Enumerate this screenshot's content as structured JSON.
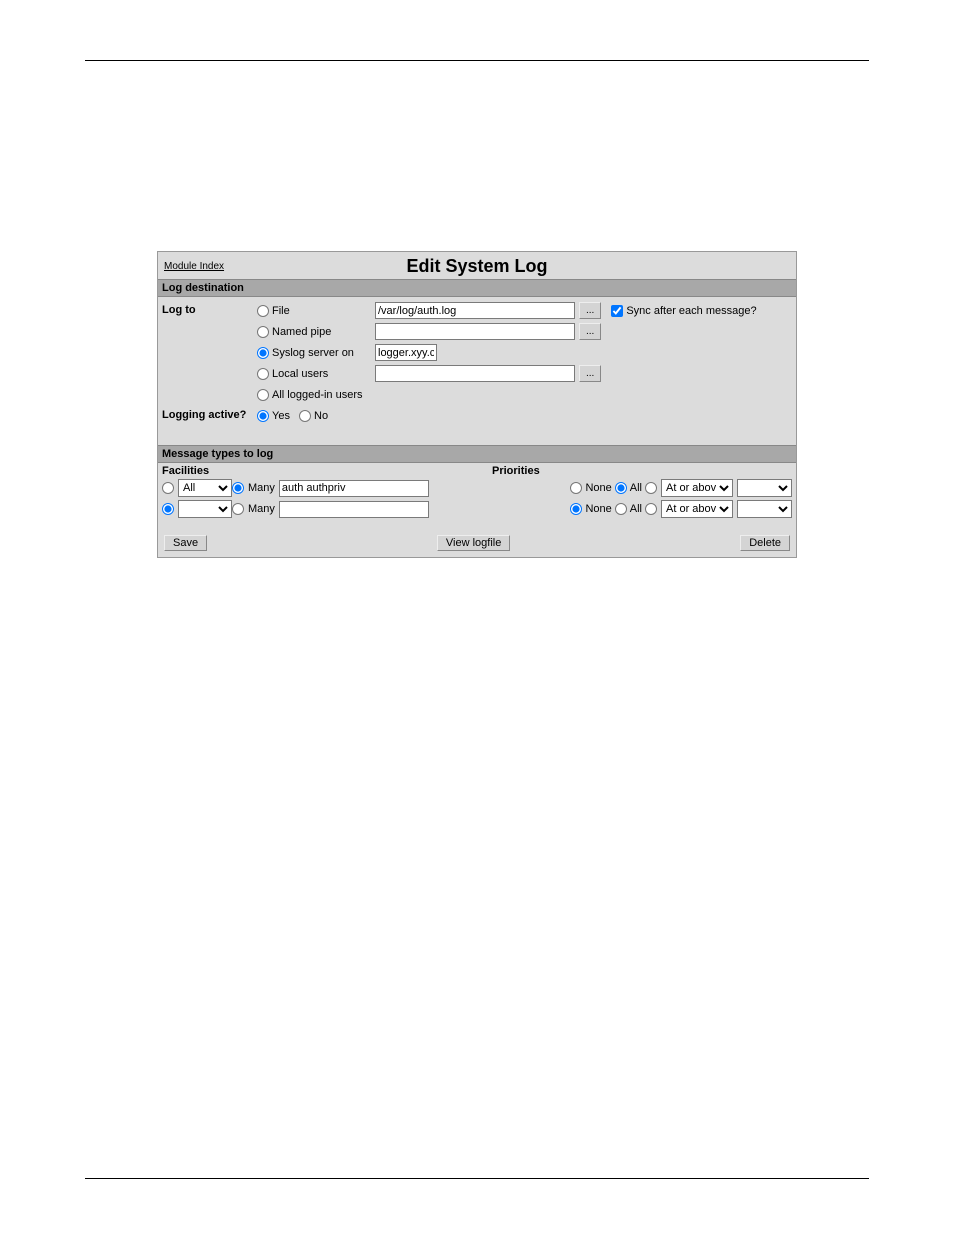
{
  "header": {
    "module_index": "Module Index",
    "title": "Edit System Log"
  },
  "log_destination": {
    "section_title": "Log destination",
    "log_to_label": "Log to",
    "options": {
      "file": "File",
      "named_pipe": "Named pipe",
      "syslog_server": "Syslog server on",
      "local_users": "Local users",
      "all_logged_in": "All logged-in users"
    },
    "file_value": "/var/log/auth.log",
    "named_pipe_value": "",
    "syslog_server_value": "logger.xyy.co",
    "local_users_value": "",
    "ellipsis": "...",
    "sync_label": "Sync after each message?",
    "logging_active_label": "Logging active?",
    "yes": "Yes",
    "no": "No"
  },
  "message_types": {
    "section_title": "Message types to log",
    "facilities_label": "Facilities",
    "priorities_label": "Priorities",
    "many_label": "Many",
    "none_label": "None",
    "all_label": "All",
    "at_or_above": "At or above..",
    "row1": {
      "facility_select": "All",
      "many_value": "auth authpriv"
    },
    "row2": {
      "facility_select": "",
      "many_value": ""
    }
  },
  "buttons": {
    "save": "Save",
    "view_logfile": "View logfile",
    "delete": "Delete"
  }
}
